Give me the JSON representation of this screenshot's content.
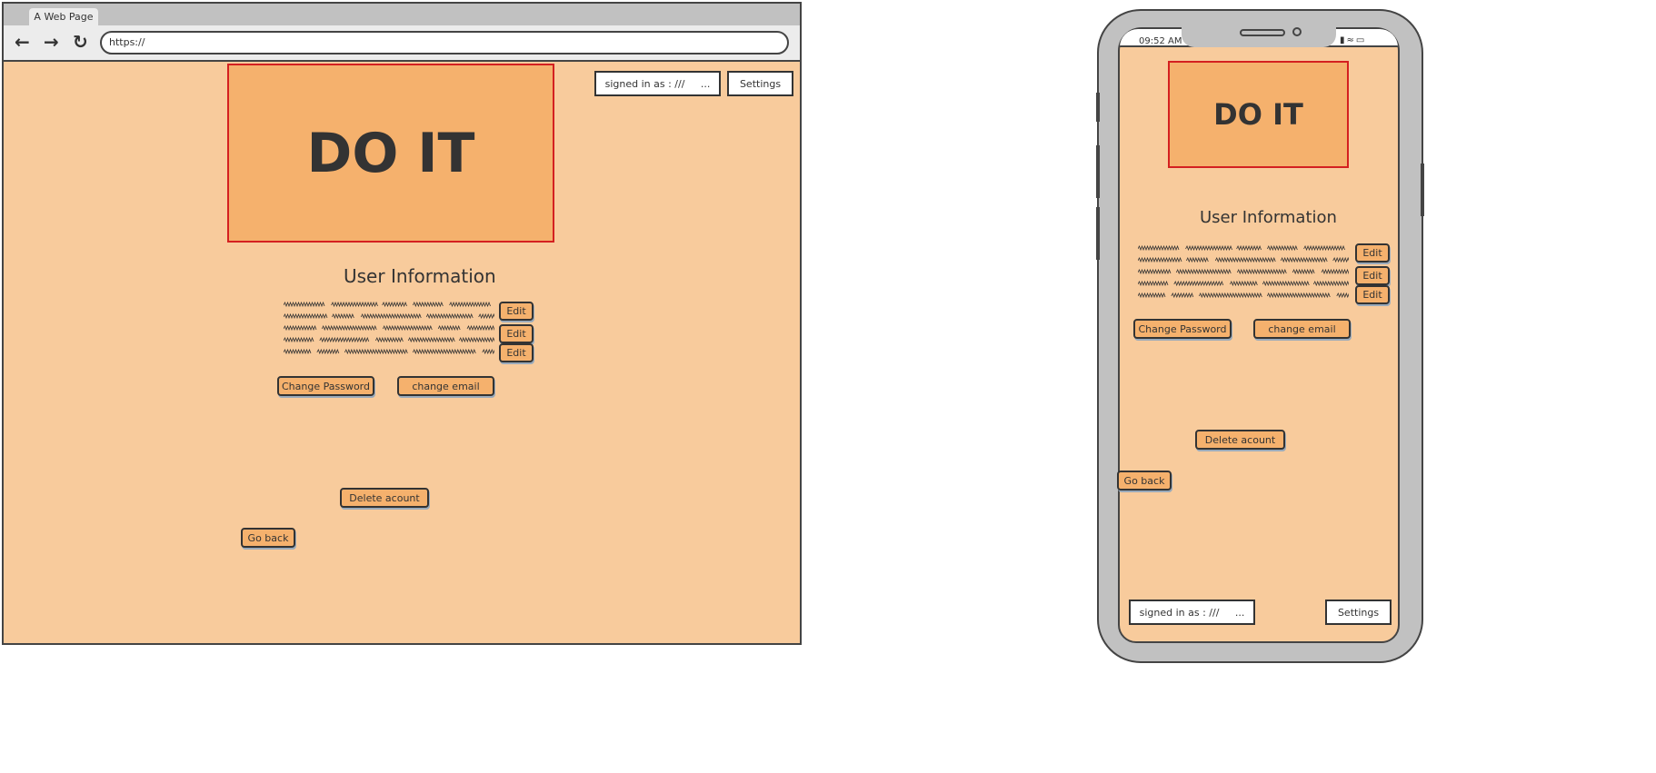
{
  "browser": {
    "tab_title": "A Web Page",
    "url": "https://",
    "back_icon": "arrow-left",
    "forward_icon": "arrow-right",
    "reload_icon": "reload"
  },
  "desktop": {
    "logo": "DO IT",
    "signed_in": "signed in as : ///     ...",
    "settings": "Settings",
    "section_title": "User Information",
    "edit": "Edit",
    "change_password": "Change Password",
    "change_email": "change email",
    "delete_account": "Delete acount",
    "go_back": "Go back"
  },
  "mobile": {
    "time": "09:52 AM",
    "logo": "DO IT",
    "signed_in": "signed in as : ///     ...",
    "settings": "Settings",
    "section_title": "User Information",
    "edit": "Edit",
    "change_password": "Change Password",
    "change_email": "change email",
    "delete_account": "Delete acount",
    "go_back": "Go back"
  },
  "colors": {
    "background": "#f8cb9c",
    "accent": "#f5b16d",
    "logo_border": "#d42020"
  }
}
